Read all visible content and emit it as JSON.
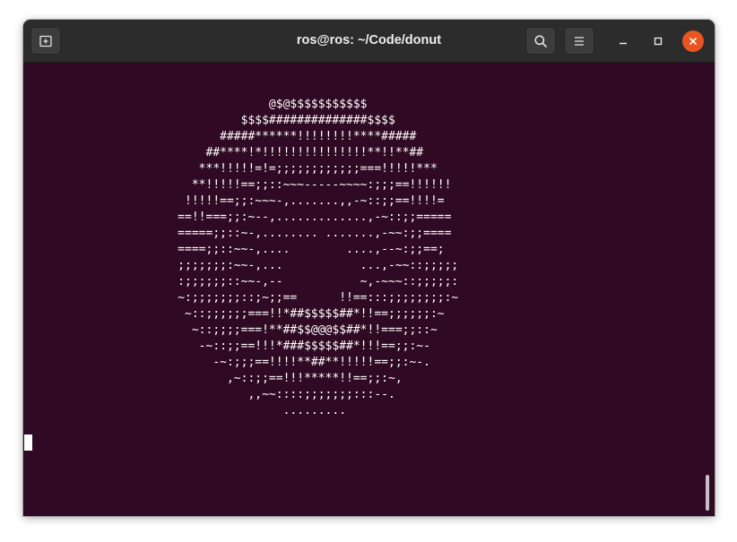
{
  "window": {
    "title": "ros@ros: ~/Code/donut"
  },
  "header": {
    "new_tab_icon": "new-tab-icon",
    "search_icon": "search-icon",
    "menu_icon": "hamburger-menu-icon",
    "minimize_icon": "minimize-icon",
    "maximize_icon": "maximize-icon",
    "close_icon": "close-icon"
  },
  "colors": {
    "terminal_background": "#300a24",
    "titlebar_background": "#2c2c2c",
    "close_button": "#e95420",
    "text": "#ffffff"
  },
  "terminal": {
    "output": "                                   @$@$$$$$$$$$$$\n                               $$$$##############$$$$\n                            #####******!!!!!!!!****#####\n                          ##****!*!!!!!!!!!!!!!!!**!!**##\n                         ***!!!!!=!=;;;;;;;;;;;;===!!!!!***\n                        **!!!!!==;;::~~~-----~~~~:;;;==!!!!!!\n                       !!!!!==;;:~~~-,.......,,-~::;;==!!!!=\n                      ==!!===;;:~--,.............,-~::;;=====\n                      =====;;::~-,........ .......,-~~:;;====\n                      ====;;::~~-,....        ....,--~:;;==;\n                      ;;;;;;;:~~-,...           ...,-~~::;;;;;\n                      :;;;;;;::~~-,--           ~,-~~~::;;;;;:\n                      ~:;;;;;;;::;~;;==      !!==:::;;;;;;;;:~\n                       ~::;;;;;;===!!*##$$$$$##*!!==;;;;;;:~\n                        ~::;;;;===!**##$$@@@$$##*!!===;;::~\n                         -~::;;==!!!*###$$$$$##*!!!==;;:~-\n                           -~:;;;==!!!!**##**!!!!!==;;:~-.\n                             ,~::;;==!!!*****!!==;;:~,\n                                ,,~~::::;;;;;;;:::--.\n                                     .........\n"
  }
}
